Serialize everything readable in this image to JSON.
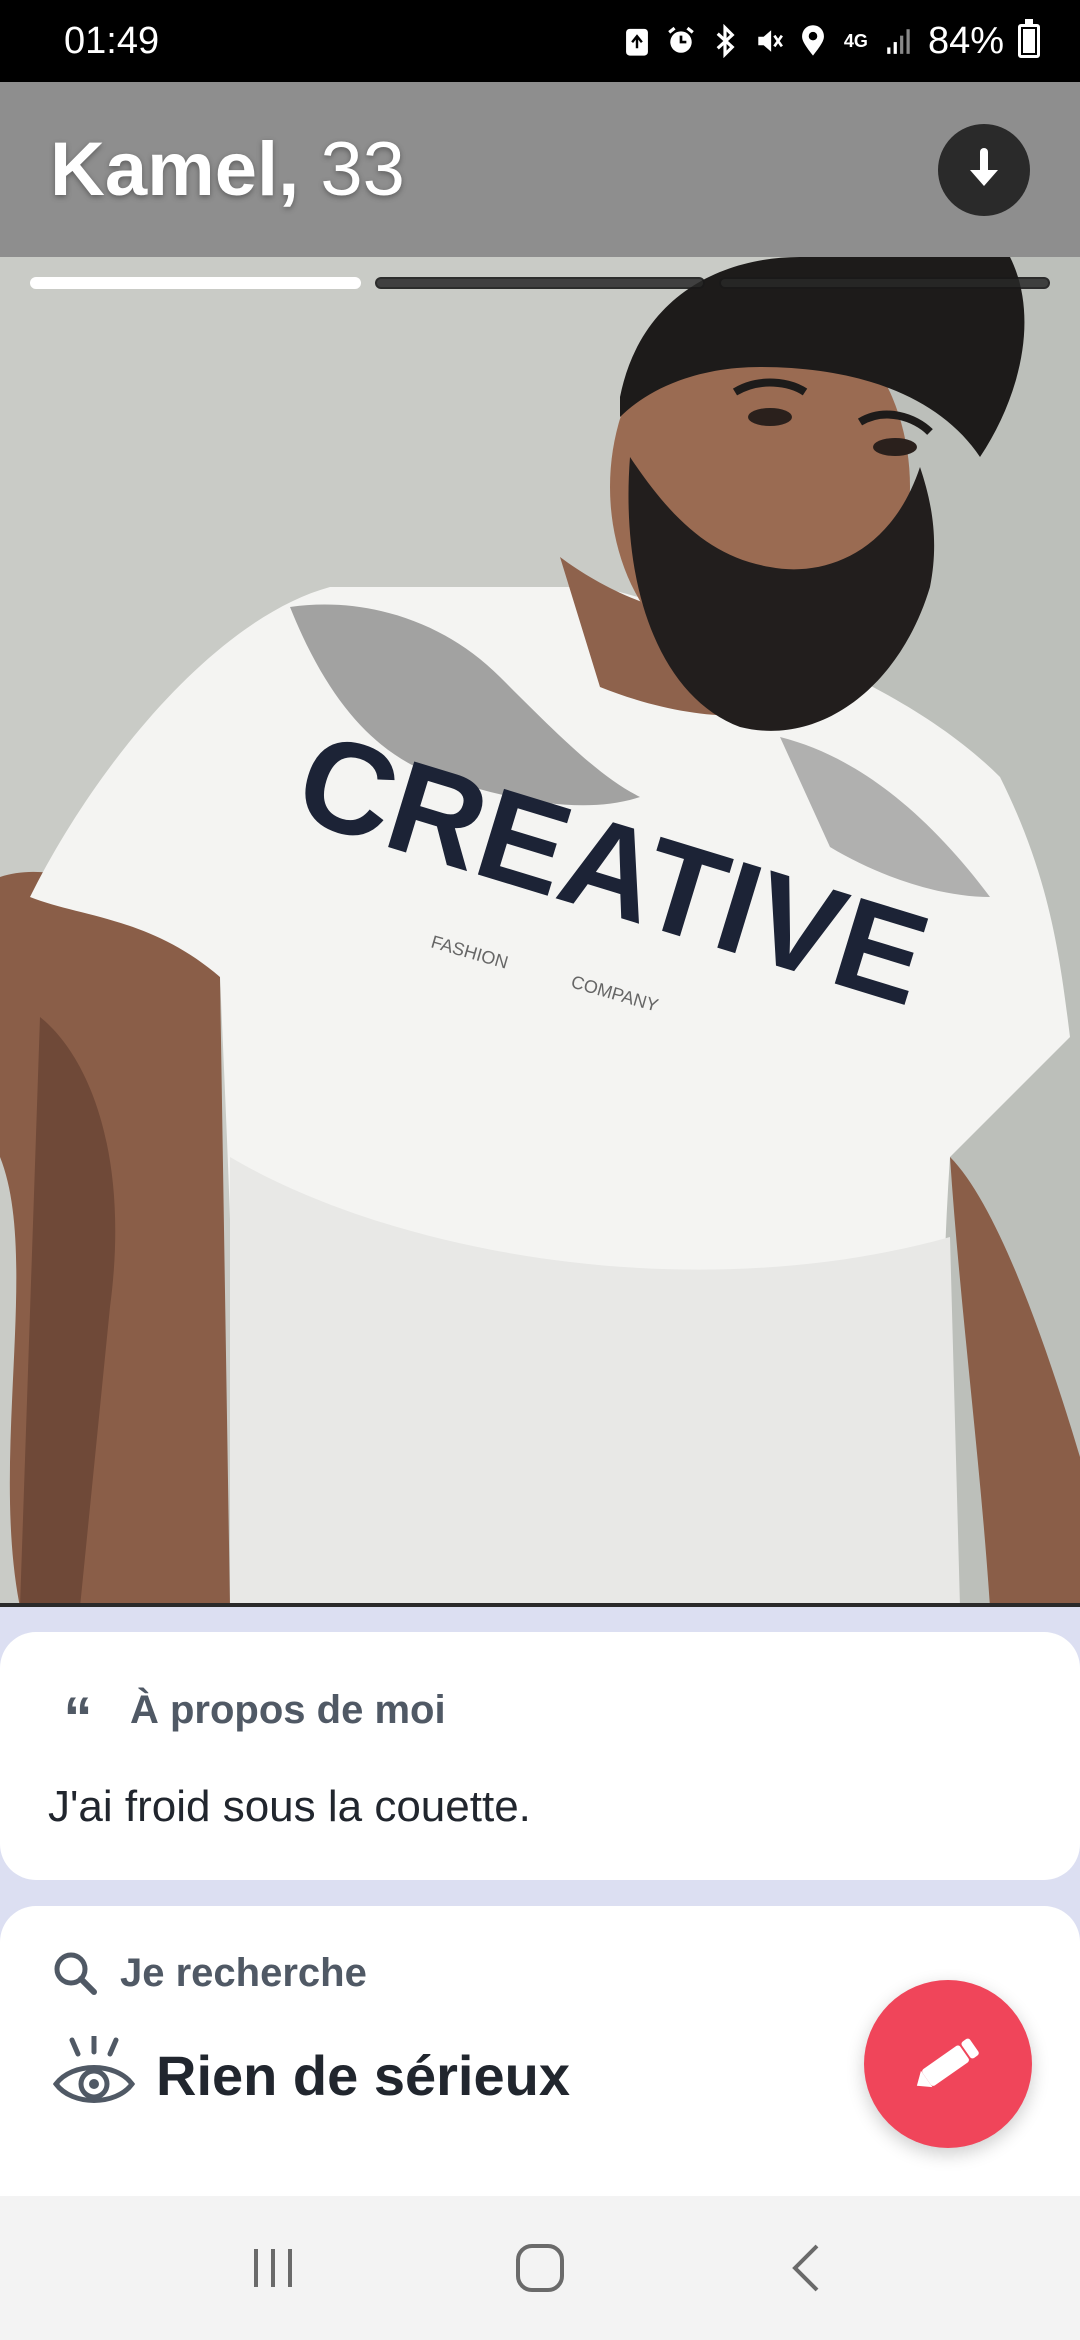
{
  "status_bar": {
    "time": "01:49",
    "network": "4G",
    "battery": "84%",
    "battery_level": 0.84,
    "icons": [
      "recycle-icon",
      "alarm-icon",
      "bluetooth-icon",
      "mute-icon",
      "location-icon",
      "network-4g-icon",
      "signal-icon",
      "battery-icon"
    ]
  },
  "profile": {
    "name": "Kamel,",
    "age": "33",
    "photo_count": 3,
    "active_photo_index": 0
  },
  "photo": {
    "shirt_text": "CREATIVE",
    "shirt_subtext_left": "FASHION",
    "shirt_subtext_right": "COMPANY"
  },
  "about": {
    "heading": "À propos de moi",
    "text": "J'ai froid sous la couette."
  },
  "looking_for": {
    "heading": "Je recherche",
    "value": "Rien de sérieux"
  },
  "colors": {
    "accent": "#f0455a",
    "header_bg": "#8e8e8e",
    "page_bg": "#dcdff2"
  }
}
